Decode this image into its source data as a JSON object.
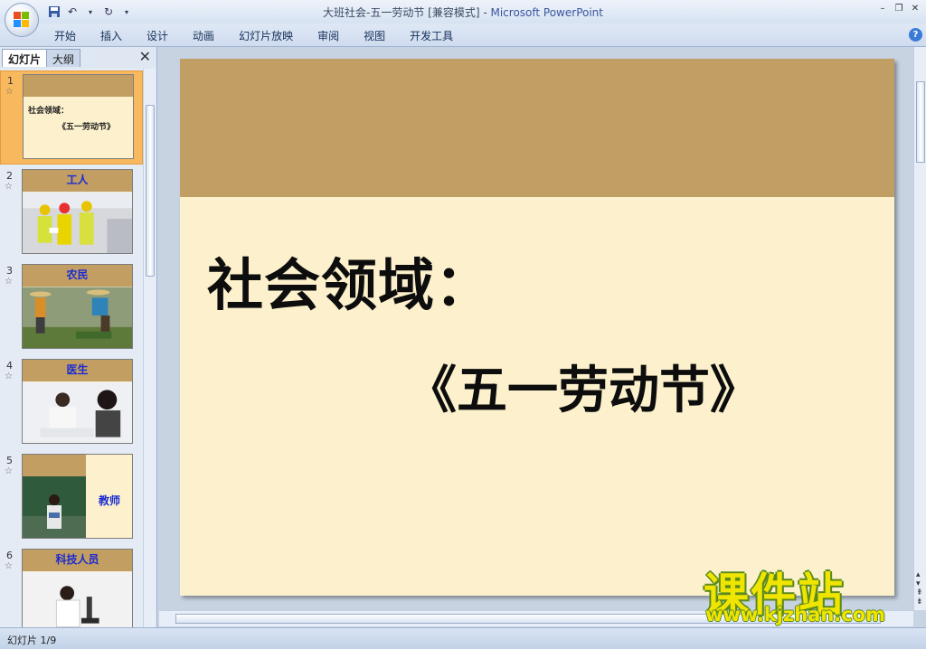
{
  "window": {
    "title_doc": "大班社会-五一劳动节 [兼容模式] - ",
    "title_app": "Microsoft PowerPoint"
  },
  "ribbon": {
    "tabs": [
      "开始",
      "插入",
      "设计",
      "动画",
      "幻灯片放映",
      "审阅",
      "视图",
      "开发工具"
    ],
    "help": "?"
  },
  "panel": {
    "tab_slides": "幻灯片",
    "tab_outline": "大纲",
    "close": "✕",
    "thumbs": [
      {
        "num": "1",
        "title": "",
        "line1": "社会领域：",
        "line2": "《五一劳动节》"
      },
      {
        "num": "2",
        "title": "工人"
      },
      {
        "num": "3",
        "title": "农民"
      },
      {
        "num": "4",
        "title": "医生"
      },
      {
        "num": "5",
        "title": "教师"
      },
      {
        "num": "6",
        "title": "科技人员"
      }
    ]
  },
  "slide": {
    "title_line1": "社会领域：",
    "title_line2": "《五一劳动节》"
  },
  "status": {
    "text": "幻灯片 1/9"
  },
  "watermark": {
    "cn": "课件站",
    "url": "www.kjzhan.com"
  },
  "colors": {
    "slide_band": "#c19e63",
    "slide_bg": "#fcf1cc",
    "thumb_title": "#1a2bd2",
    "selected_thumb": "#f8b85e"
  }
}
